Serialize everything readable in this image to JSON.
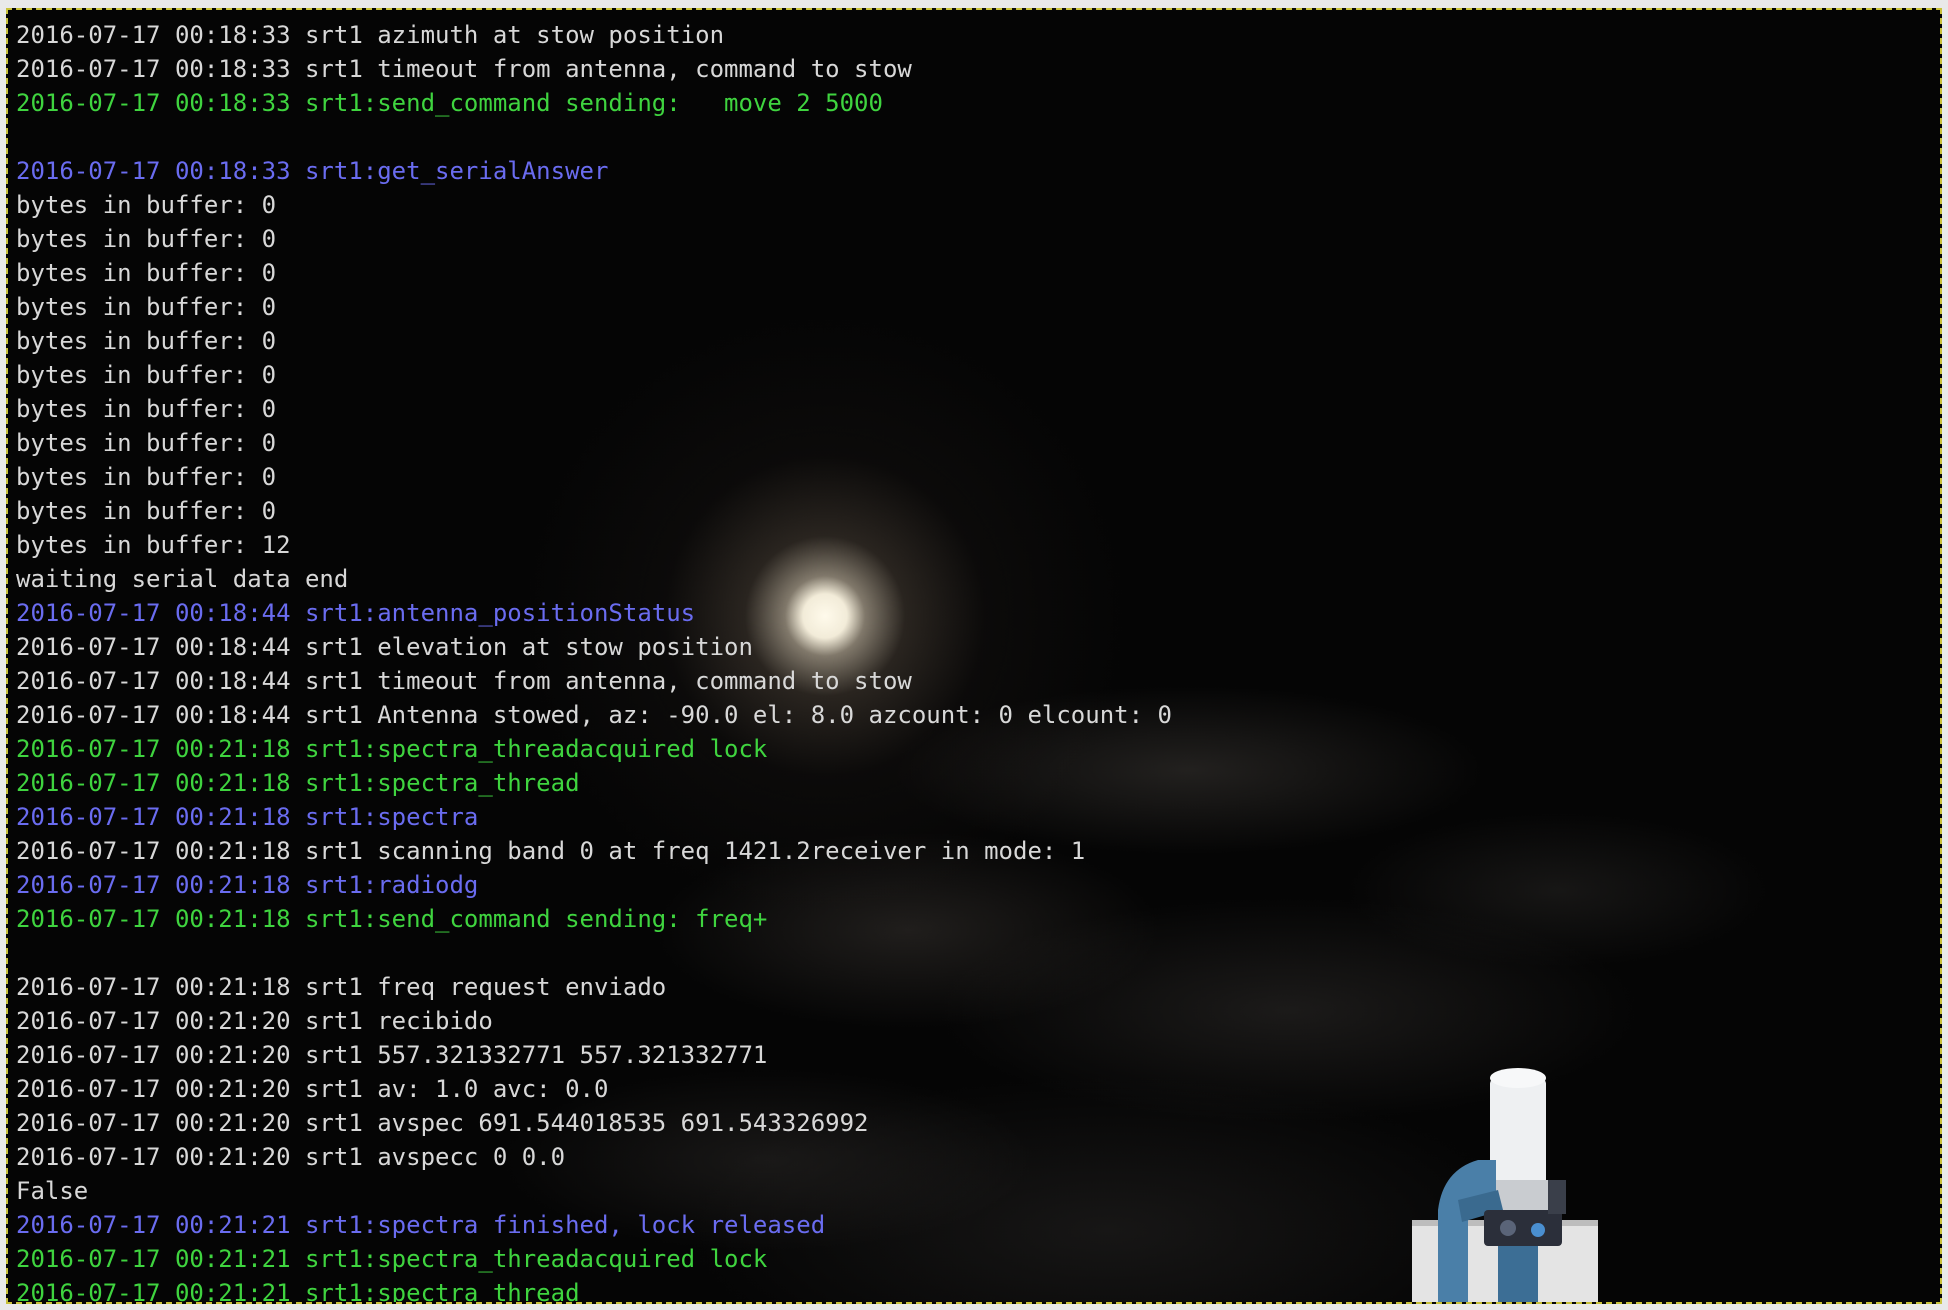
{
  "colors": {
    "white": "#d8d8d8",
    "green": "#3fd43f",
    "blue": "#6a6cf0",
    "background": "#050505"
  },
  "terminal": {
    "lines": [
      {
        "text": "2016-07-17 00:18:33 srt1 azimuth at stow position",
        "color": "white"
      },
      {
        "text": "2016-07-17 00:18:33 srt1 timeout from antenna, command to stow",
        "color": "white"
      },
      {
        "text": "2016-07-17 00:18:33 srt1:send_command sending:   move 2 5000",
        "color": "green"
      },
      {
        "text": "",
        "color": "white"
      },
      {
        "text": "2016-07-17 00:18:33 srt1:get_serialAnswer",
        "color": "blue"
      },
      {
        "text": "bytes in buffer: 0",
        "color": "white"
      },
      {
        "text": "bytes in buffer: 0",
        "color": "white"
      },
      {
        "text": "bytes in buffer: 0",
        "color": "white"
      },
      {
        "text": "bytes in buffer: 0",
        "color": "white"
      },
      {
        "text": "bytes in buffer: 0",
        "color": "white"
      },
      {
        "text": "bytes in buffer: 0",
        "color": "white"
      },
      {
        "text": "bytes in buffer: 0",
        "color": "white"
      },
      {
        "text": "bytes in buffer: 0",
        "color": "white"
      },
      {
        "text": "bytes in buffer: 0",
        "color": "white"
      },
      {
        "text": "bytes in buffer: 0",
        "color": "white"
      },
      {
        "text": "bytes in buffer: 12",
        "color": "white"
      },
      {
        "text": "waiting serial data end",
        "color": "white"
      },
      {
        "text": "2016-07-17 00:18:44 srt1:antenna_positionStatus",
        "color": "blue"
      },
      {
        "text": "2016-07-17 00:18:44 srt1 elevation at stow position",
        "color": "white"
      },
      {
        "text": "2016-07-17 00:18:44 srt1 timeout from antenna, command to stow",
        "color": "white"
      },
      {
        "text": "2016-07-17 00:18:44 srt1 Antenna stowed, az: -90.0 el: 8.0 azcount: 0 elcount: 0",
        "color": "white"
      },
      {
        "text": "2016-07-17 00:21:18 srt1:spectra_threadacquired lock",
        "color": "green"
      },
      {
        "text": "2016-07-17 00:21:18 srt1:spectra_thread",
        "color": "green"
      },
      {
        "text": "2016-07-17 00:21:18 srt1:spectra",
        "color": "blue"
      },
      {
        "text": "2016-07-17 00:21:18 srt1 scanning band 0 at freq 1421.2receiver in mode: 1",
        "color": "white"
      },
      {
        "text": "2016-07-17 00:21:18 srt1:radiodg",
        "color": "blue"
      },
      {
        "text": "2016-07-17 00:21:18 srt1:send_command sending: freq+",
        "color": "green"
      },
      {
        "text": "",
        "color": "white"
      },
      {
        "text": "2016-07-17 00:21:18 srt1 freq request enviado",
        "color": "white"
      },
      {
        "text": "2016-07-17 00:21:20 srt1 recibido",
        "color": "white"
      },
      {
        "text": "2016-07-17 00:21:20 srt1 557.321332771 557.321332771",
        "color": "white"
      },
      {
        "text": "2016-07-17 00:21:20 srt1 av: 1.0 avc: 0.0",
        "color": "white"
      },
      {
        "text": "2016-07-17 00:21:20 srt1 avspec 691.544018535 691.543326992",
        "color": "white"
      },
      {
        "text": "2016-07-17 00:21:20 srt1 avspecc 0 0.0",
        "color": "white"
      },
      {
        "text": "False",
        "color": "white"
      },
      {
        "text": "2016-07-17 00:21:21 srt1:spectra finished, lock released",
        "color": "blue"
      },
      {
        "text": "2016-07-17 00:21:21 srt1:spectra_threadacquired lock",
        "color": "green"
      },
      {
        "text": "2016-07-17 00:21:21 srt1:spectra_thread",
        "color": "green"
      }
    ]
  }
}
